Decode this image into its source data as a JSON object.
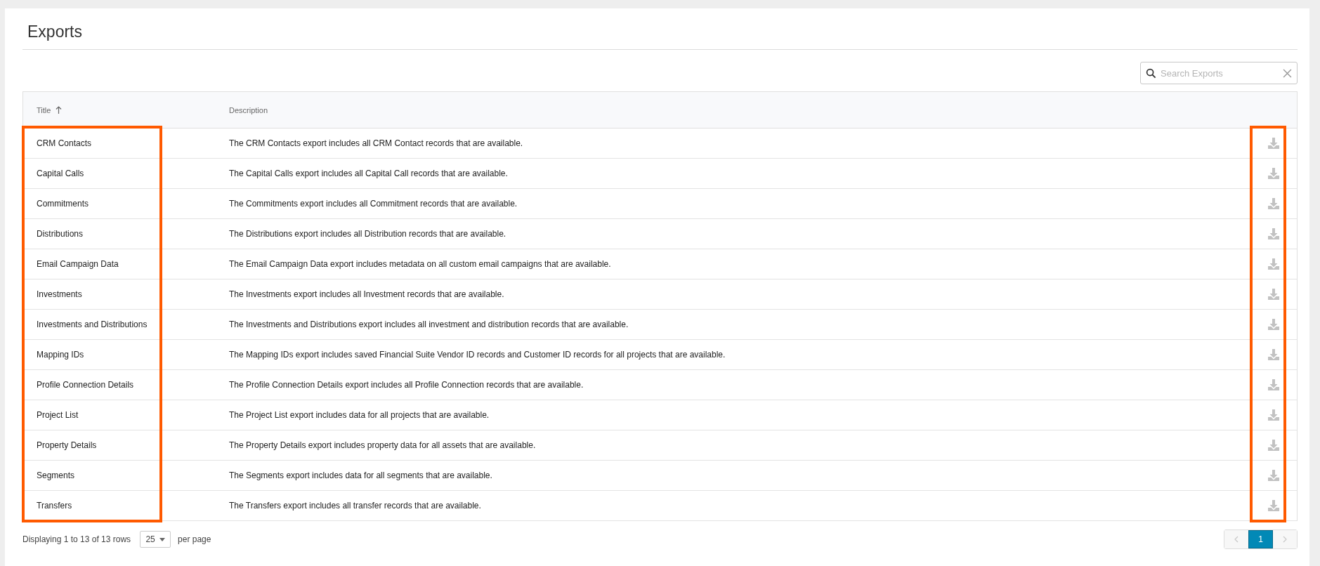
{
  "page": {
    "title": "Exports"
  },
  "search": {
    "placeholder": "Search Exports"
  },
  "table": {
    "columns": [
      {
        "label": "Title",
        "sorted": true,
        "highlighted": true
      },
      {
        "label": "Description",
        "sorted": false
      }
    ],
    "download_column": {
      "highlighted": true
    },
    "rows": [
      {
        "title": "CRM Contacts",
        "description": "The CRM Contacts export includes all CRM Contact records that are available."
      },
      {
        "title": "Capital Calls",
        "description": "The Capital Calls export includes all Capital Call records that are available."
      },
      {
        "title": "Commitments",
        "description": "The Commitments export includes all Commitment records that are available."
      },
      {
        "title": "Distributions",
        "description": "The Distributions export includes all Distribution records that are available."
      },
      {
        "title": "Email Campaign Data",
        "description": "The Email Campaign Data export includes metadata on all custom email campaigns that are available."
      },
      {
        "title": "Investments",
        "description": "The Investments export includes all Investment records that are available."
      },
      {
        "title": "Investments and Distributions",
        "description": "The Investments and Distributions export includes all investment and distribution records that are available."
      },
      {
        "title": "Mapping IDs",
        "description": "The Mapping IDs export includes saved Financial Suite Vendor ID records and Customer ID records for all projects that are available."
      },
      {
        "title": "Profile Connection Details",
        "description": "The Profile Connection Details export includes all Profile Connection records that are available."
      },
      {
        "title": "Project List",
        "description": "The Project List export includes data for all projects that are available."
      },
      {
        "title": "Property Details",
        "description": "The Property Details export includes property data for all assets that are available."
      },
      {
        "title": "Segments",
        "description": "The Segments export includes data for all segments that are available."
      },
      {
        "title": "Transfers",
        "description": "The Transfers export includes all transfer records that are available."
      }
    ]
  },
  "footer": {
    "summary": "Displaying 1 to 13 of 13 rows",
    "page_size": "25",
    "page_size_label": "per page",
    "previous_disabled": true,
    "next_disabled": true,
    "pages": [
      {
        "label": "1",
        "selected": true
      }
    ]
  }
}
